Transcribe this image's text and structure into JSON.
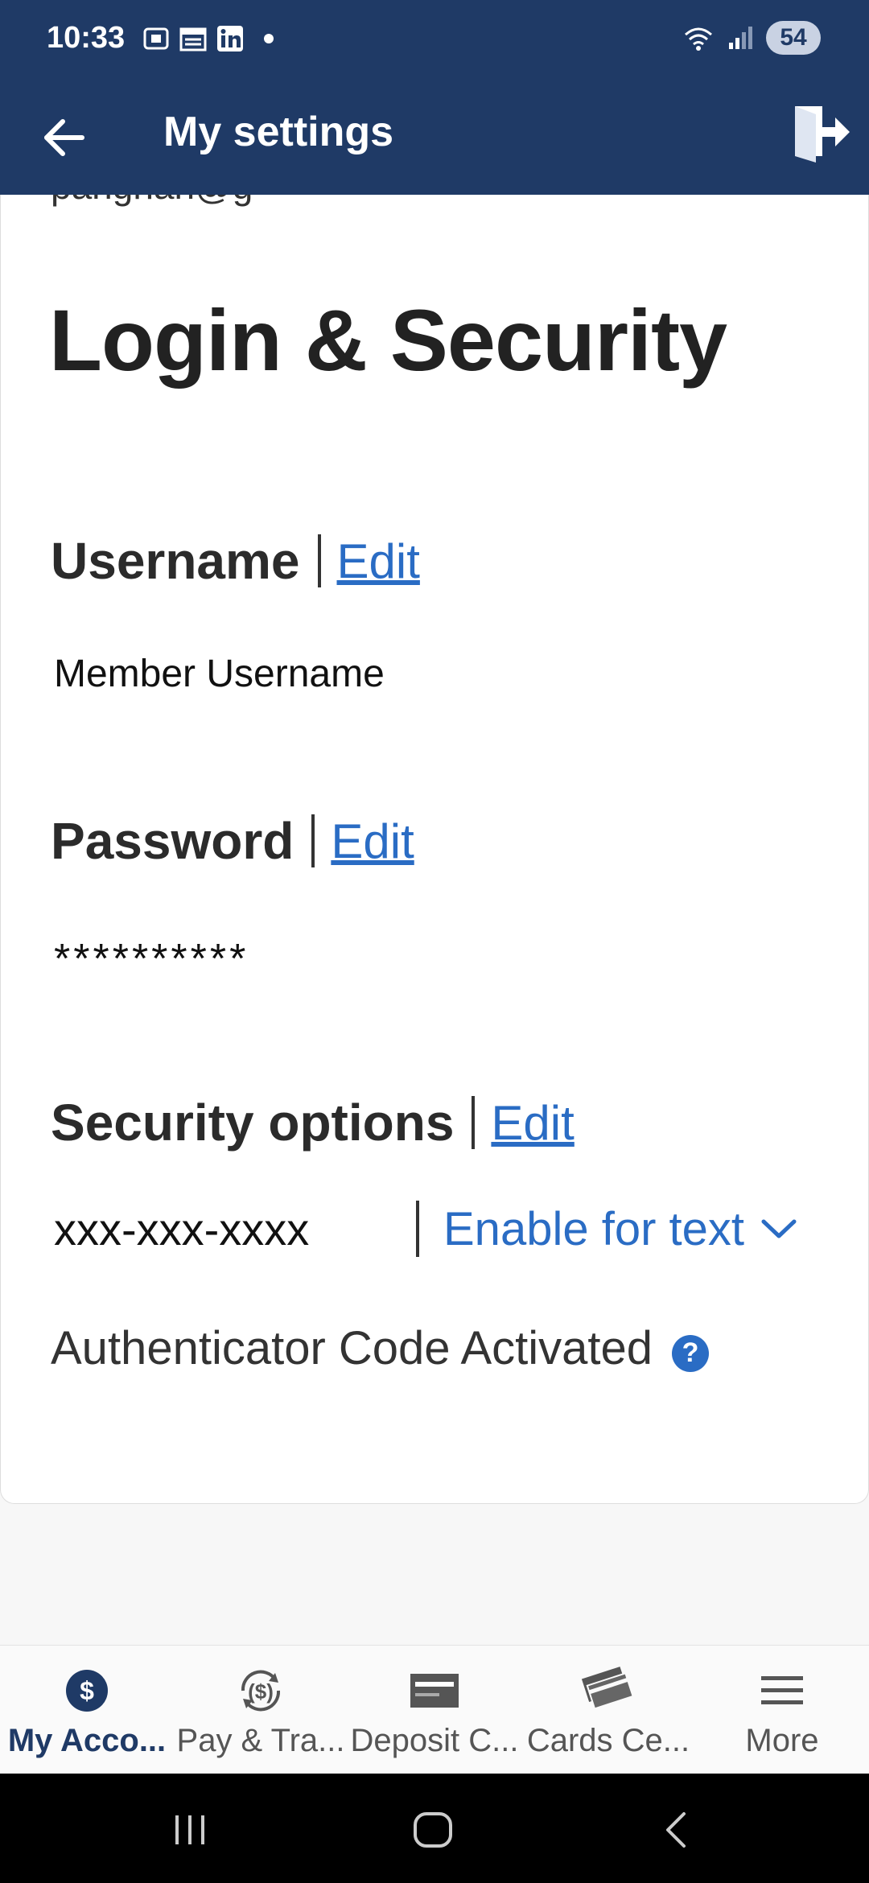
{
  "status_bar": {
    "time": "10:33",
    "battery": "54",
    "icons": [
      "screenshot-icon",
      "calendar-icon",
      "linkedin-icon",
      "notification-dot",
      "wifi-icon",
      "signal-icon"
    ]
  },
  "app_bar": {
    "title": "My settings",
    "back_icon": "back-arrow-icon",
    "exit_icon": "logout-icon"
  },
  "content": {
    "cut_text": "panghan@g",
    "page_title": "Login & Security",
    "username": {
      "heading": "Username",
      "edit_label": "Edit",
      "value": "Member Username"
    },
    "password": {
      "heading": "Password",
      "edit_label": "Edit",
      "value": "**********"
    },
    "security": {
      "heading": "Security options",
      "edit_label": "Edit",
      "phone": "xxx-xxx-xxxx",
      "enable_label": "Enable for text",
      "auth_text": "Authenticator Code Activated",
      "help_icon": "?"
    }
  },
  "bottom_nav": {
    "items": [
      {
        "label": "My Acco...",
        "icon": "dollar-circle-icon",
        "active": true
      },
      {
        "label": "Pay & Tra...",
        "icon": "transfer-icon",
        "active": false
      },
      {
        "label": "Deposit C...",
        "icon": "check-deposit-icon",
        "active": false
      },
      {
        "label": "Cards Ce...",
        "icon": "cards-icon",
        "active": false
      },
      {
        "label": "More",
        "icon": "menu-icon",
        "active": false
      }
    ]
  },
  "colors": {
    "header": "#1f3a66",
    "link": "#2a6cc4",
    "text": "#222222"
  }
}
